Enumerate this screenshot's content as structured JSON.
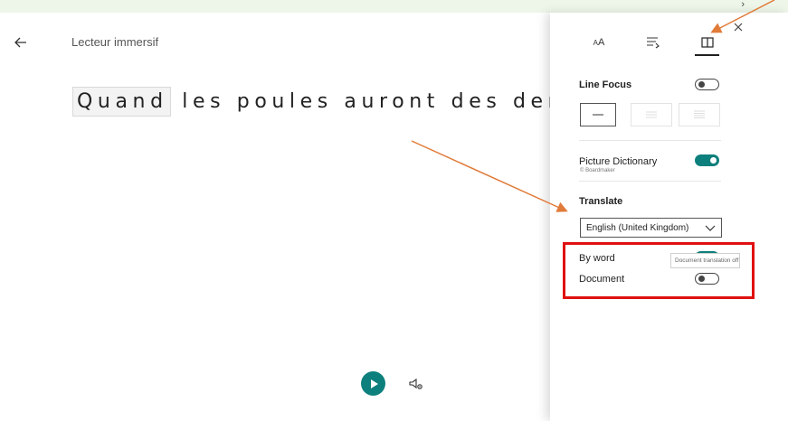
{
  "app": {
    "title": "Lecteur immersif"
  },
  "reading": {
    "focused_word": "Quand",
    "rest": " les poules auront des den"
  },
  "toolbar": {
    "tabs": [
      {
        "icon": "text-size-icon",
        "label": "AA"
      },
      {
        "icon": "grammar-options-icon"
      },
      {
        "icon": "reading-preferences-icon"
      }
    ]
  },
  "panel": {
    "line_focus": {
      "label": "Line Focus",
      "enabled": false
    },
    "picture_dictionary": {
      "label": "Picture Dictionary",
      "sublabel": "© Boardmaker",
      "enabled": true
    },
    "translate": {
      "label": "Translate",
      "selected_language": "English (United Kingdom)",
      "by_word": {
        "label": "By word",
        "enabled": true
      },
      "document": {
        "label": "Document",
        "enabled": false
      },
      "tooltip": "Document translation off"
    }
  },
  "colors": {
    "accent": "#0d7f7c",
    "annotation_arrow": "#e07b39",
    "highlight_box": "#e01010"
  }
}
